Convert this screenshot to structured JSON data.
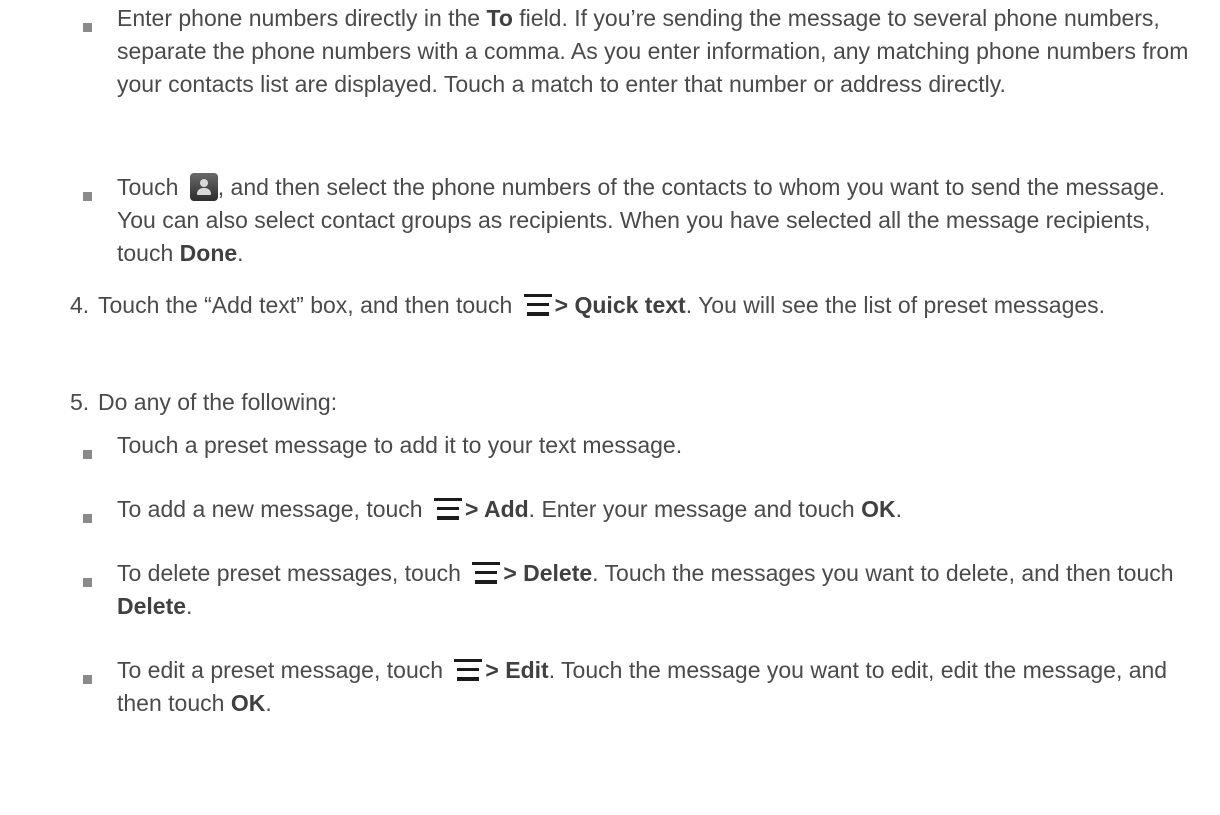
{
  "bullets": {
    "b1": {
      "t1": "Enter phone numbers directly in the ",
      "b1": "To",
      "t2": " field. If you’re sending the message to several phone numbers, separate the phone numbers with a comma. As you enter information, any matching phone numbers from your contacts list are displayed. Touch a match to enter that number or address directly."
    },
    "b2": {
      "t1": "Touch ",
      "t2": ", and then select the phone numbers of the contacts to whom you want to send the message. You can also select contact groups as recipients. When you have selected all the message recipients, touch ",
      "b1": "Done",
      "t3": ".",
      "icon": "contact-icon"
    }
  },
  "steps": {
    "s4": {
      "num": "4.",
      "t1": "Touch the “Add text” box, and then touch ",
      "b1": "> Quick text",
      "t2": ". You will see the list of preset messages.",
      "icon": "menu-icon"
    },
    "s5": {
      "num": "5.",
      "t1": "Do any of the following:"
    }
  },
  "options": {
    "o1": {
      "t1": "Touch a preset message to add it to your text message."
    },
    "o2": {
      "t1": "To add a new message, touch ",
      "b1": "> Add",
      "t2": ". Enter your message and touch ",
      "b2": "OK",
      "t3": ".",
      "icon": "menu-icon"
    },
    "o3": {
      "t1": "To delete preset messages, touch ",
      "b1": "> Delete",
      "t2": ". Touch the messages you want to delete, and then touch ",
      "b2": "Delete",
      "t3": ".",
      "icon": "menu-icon"
    },
    "o4": {
      "t1": "To edit a preset message, touch ",
      "b1": "> Edit",
      "t2": ". Touch the message you want to edit, edit the message, and then touch ",
      "b2": "OK",
      "t3": ".",
      "icon": "menu-icon"
    }
  },
  "colors": {
    "text": "#4a4a4a",
    "bullet": "#8a8a8a",
    "icon": "#1a1a1a"
  }
}
